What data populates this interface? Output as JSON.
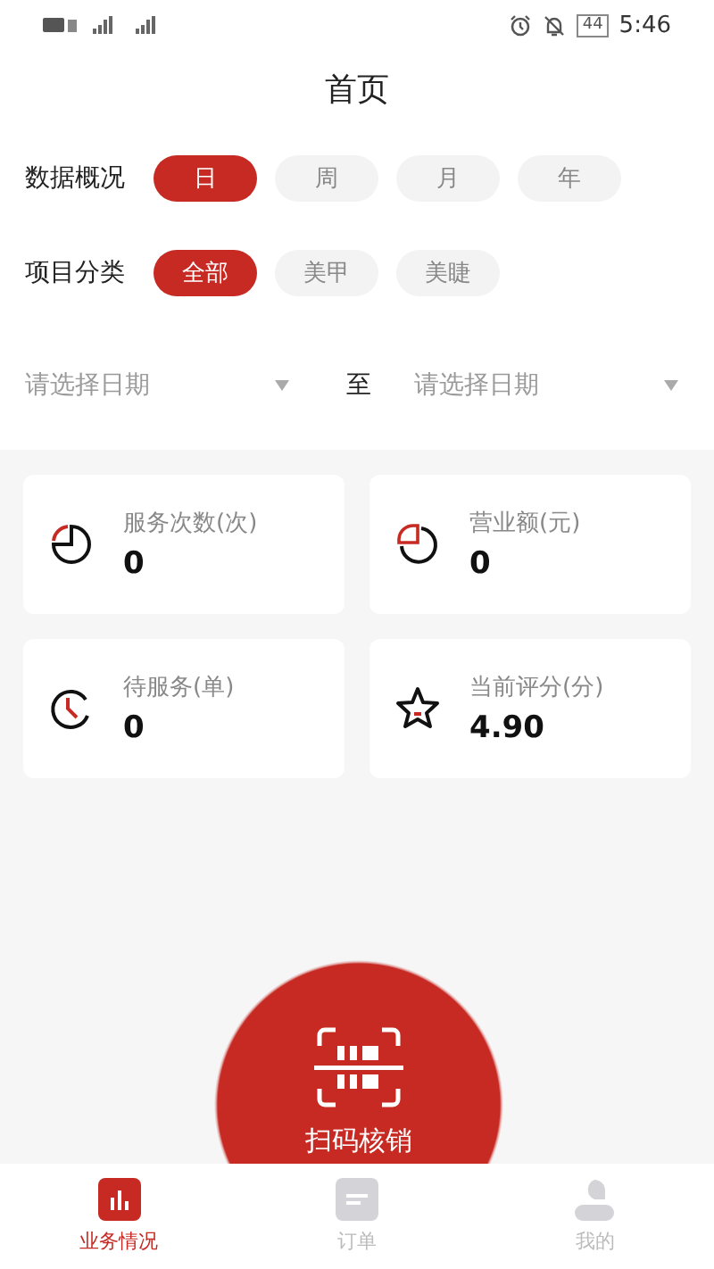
{
  "status_bar": {
    "time": "5:46",
    "battery": "44"
  },
  "title": "首页",
  "filters": [
    {
      "label": "数据概况",
      "options": [
        {
          "label": "日",
          "selected": true
        },
        {
          "label": "周",
          "selected": false
        },
        {
          "label": "月",
          "selected": false
        },
        {
          "label": "年",
          "selected": false
        }
      ]
    },
    {
      "label": "项目分类",
      "options": [
        {
          "label": "全部",
          "selected": true
        },
        {
          "label": "美甲",
          "selected": false
        },
        {
          "label": "美睫",
          "selected": false
        }
      ]
    }
  ],
  "date_range": {
    "start_placeholder": "请选择日期",
    "separator": "至",
    "end_placeholder": "请选择日期"
  },
  "stats": [
    {
      "kind": "pie",
      "label": "服务次数(次)",
      "value": "0"
    },
    {
      "kind": "pie-open",
      "label": "营业额(元)",
      "value": "0"
    },
    {
      "kind": "clock",
      "label": "待服务(单)",
      "value": "0"
    },
    {
      "kind": "star",
      "label": "当前评分(分)",
      "value": "4.90"
    }
  ],
  "scan_button": {
    "label": "扫码核销"
  },
  "tabs": [
    {
      "label": "业务情况",
      "selected": true
    },
    {
      "label": "订单",
      "selected": false
    },
    {
      "label": "我的",
      "selected": false
    }
  ]
}
